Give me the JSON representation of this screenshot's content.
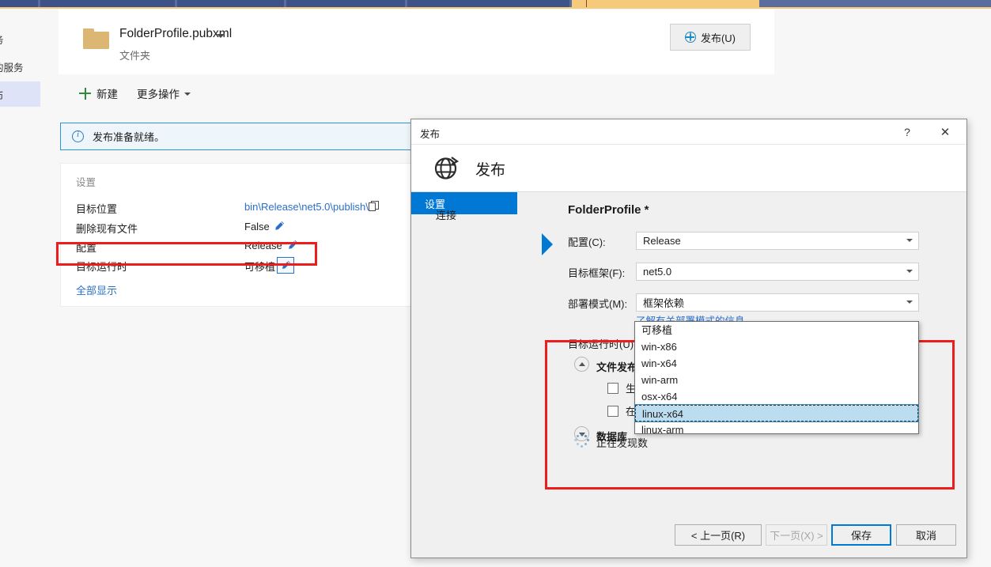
{
  "tabstrip": {
    "accent_color": "#f5ca7b",
    "bar_color": "#5b6d9e"
  },
  "rail": {
    "items": [
      {
        "label": "务"
      },
      {
        "label": "的服务"
      },
      {
        "label": "币"
      }
    ]
  },
  "header": {
    "profile_name": "FolderProfile.pubxml",
    "profile_subtitle": "文件夹",
    "publish_button": "发布(U)"
  },
  "toolbar": {
    "new_label": "新建",
    "more_label": "更多操作"
  },
  "infobar": {
    "text": "发布准备就绪。"
  },
  "settings_card": {
    "title": "设置",
    "rows": [
      {
        "label": "目标位置",
        "value": "bin\\Release\\net5.0\\publish\\",
        "is_link": true,
        "has_copy": true,
        "has_pencil": false
      },
      {
        "label": "删除现有文件",
        "value": "False",
        "is_link": false,
        "has_copy": false,
        "has_pencil": true
      },
      {
        "label": "配置",
        "value": "Release",
        "is_link": false,
        "has_copy": false,
        "has_pencil": true
      },
      {
        "label": "目标运行时",
        "value": "可移植",
        "is_link": false,
        "has_copy": false,
        "has_pencil": true
      }
    ],
    "show_all_label": "全部显示"
  },
  "highlight_color": "#ee1d1d",
  "dialog": {
    "titlebar_text": "发布",
    "help_glyph": "?",
    "close_glyph": "✕",
    "banner_title": "发布",
    "nav": {
      "connection": "连接",
      "settings": "设置"
    },
    "form_title": "FolderProfile *",
    "fields": [
      {
        "label": "配置(C):",
        "value": "Release"
      },
      {
        "label": "目标框架(F):",
        "value": "net5.0"
      },
      {
        "label": "部署模式(M):",
        "value": "框架依赖"
      }
    ],
    "learn_link": "了解有关部署模式的信息",
    "target_runtime": {
      "label": "目标运行时(U):",
      "value": "linux-x64",
      "options": [
        "可移植",
        "win-x86",
        "win-x64",
        "win-arm",
        "osx-x64",
        "linux-x64",
        "linux-arm"
      ],
      "selected_index": 5
    },
    "sections": {
      "file_publish_options": "文件发布选项",
      "checkbox_single_file": "生成单个",
      "checkbox_before_publish": "在发布前",
      "database": "数据库",
      "discovering": "正在发现数"
    },
    "buttons": {
      "prev": "< 上一页(R)",
      "next": "下一页(X) >",
      "save": "保存",
      "cancel": "取消"
    }
  }
}
